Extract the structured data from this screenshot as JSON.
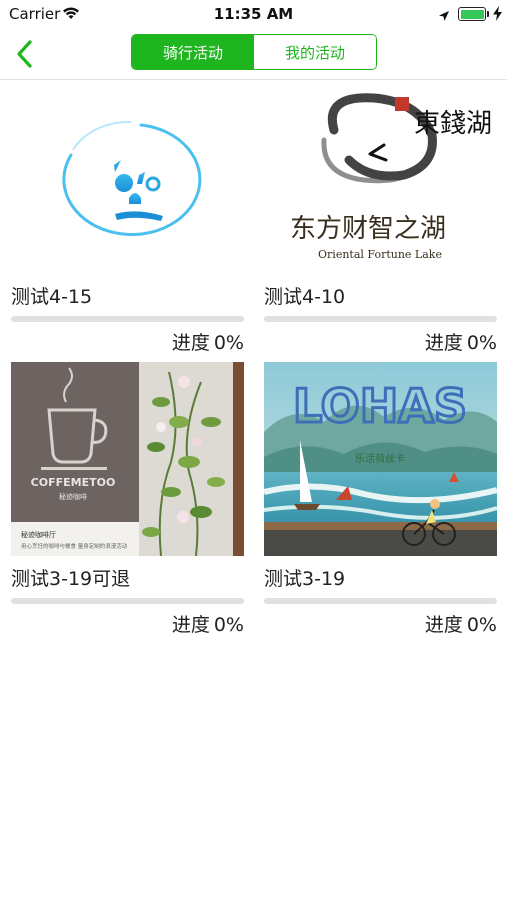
{
  "status_bar": {
    "carrier": "Carrier",
    "time": "11:35 AM",
    "icons": [
      "wifi-icon",
      "location-icon",
      "battery-icon",
      "charging-icon"
    ]
  },
  "nav": {
    "back_icon": "chevron-left-icon",
    "tabs": [
      {
        "label": "骑行活动",
        "active": true
      },
      {
        "label": "我的活动",
        "active": false
      }
    ],
    "accent_color": "#1fb51f"
  },
  "activities": [
    {
      "title": "测试4-15",
      "progress_label": "进度",
      "progress_value": "0%",
      "progress_fraction": 0,
      "image": "blue-face-logo"
    },
    {
      "title": "测试4-10",
      "progress_label": "进度",
      "progress_value": "0%",
      "progress_fraction": 0,
      "image": "east-lake-logo",
      "image_text": {
        "seal": "東錢湖",
        "chinese": "东方财智之湖",
        "english": "Oriental Fortune Lake"
      }
    },
    {
      "title": "测试3-19可退",
      "progress_label": "进度",
      "progress_value": "0%",
      "progress_fraction": 0,
      "image": "coffee-shop-photo",
      "image_text": {
        "sign": "COFFEMETOO",
        "sign_sub": "秘迹咖啡",
        "caption": "秘迹咖啡厅",
        "caption_sub": "用心烹饪的咖啡与餐食 量身定制的浪漫活动"
      }
    },
    {
      "title": "测试3-19",
      "progress_label": "进度",
      "progress_value": "0%",
      "progress_fraction": 0,
      "image": "lohas-poster",
      "image_text": {
        "brand": "LOHAS",
        "tagline": "乐活骑丝卡"
      }
    }
  ]
}
